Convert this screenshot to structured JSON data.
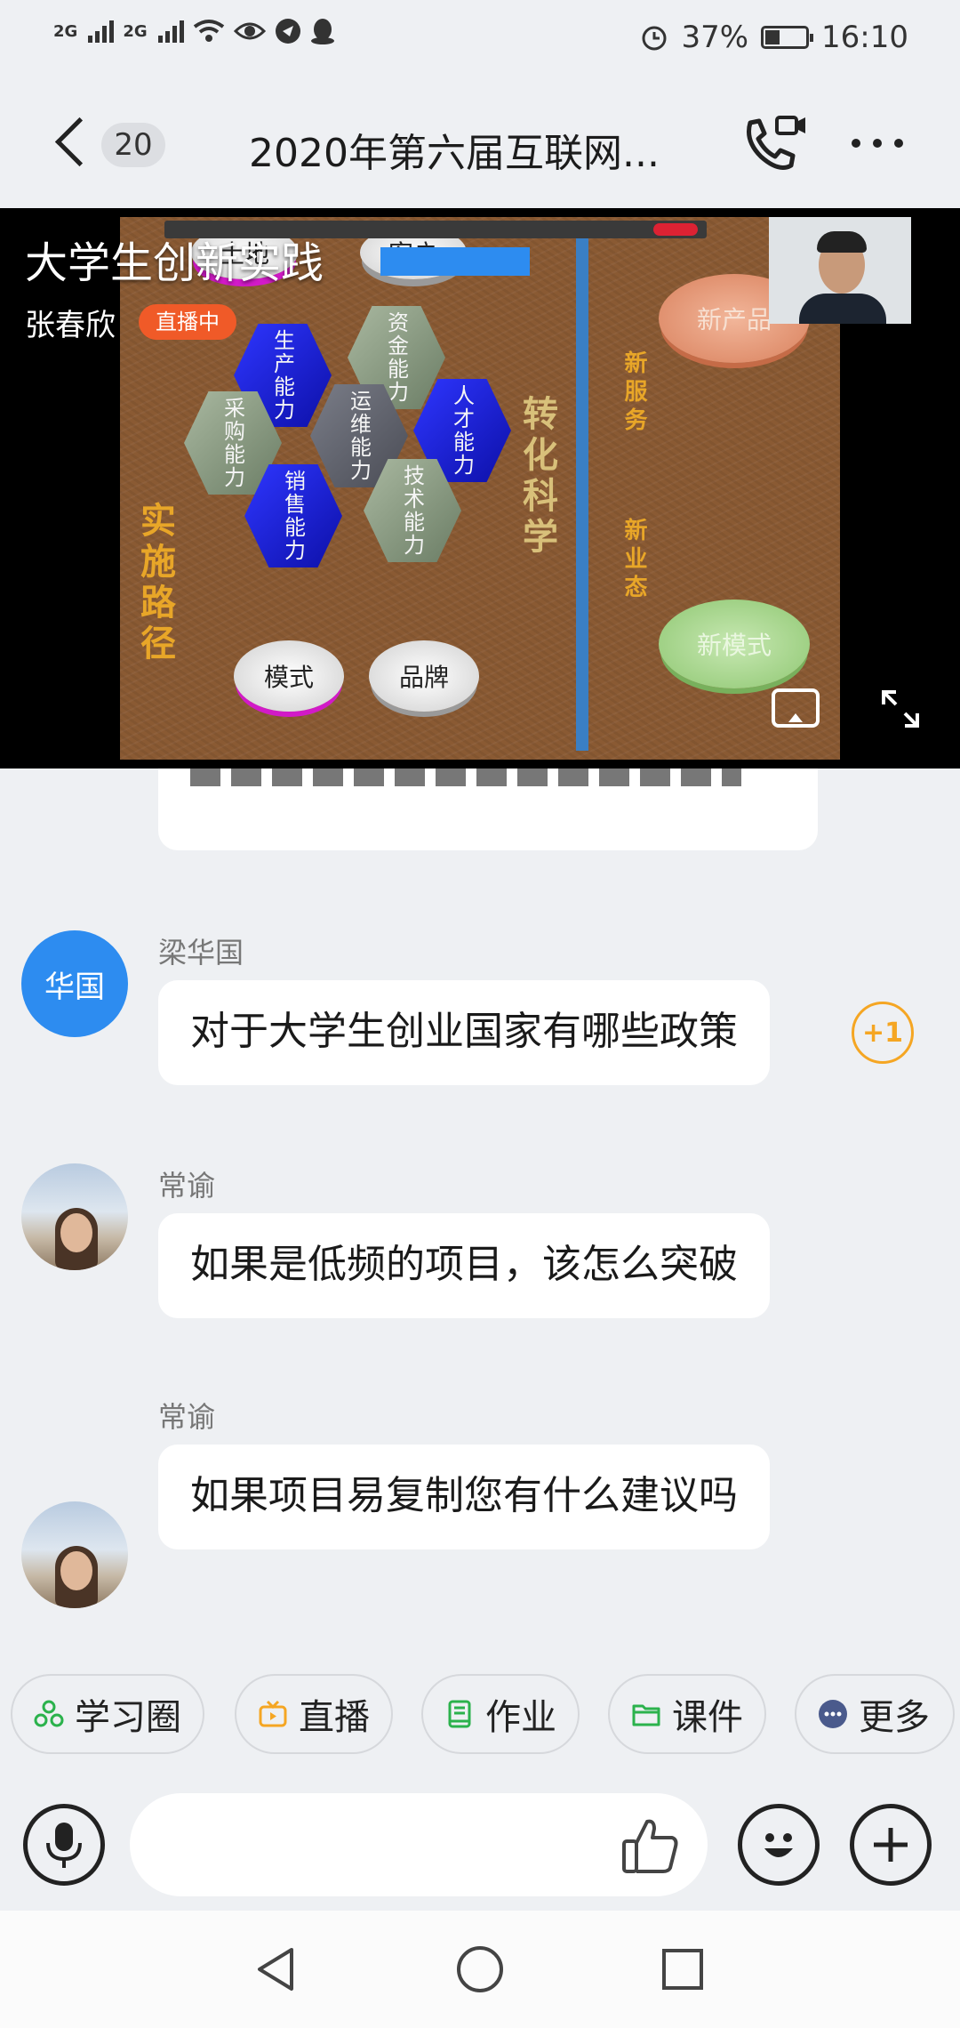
{
  "status_bar": {
    "signal1": "2G",
    "signal2": "2G",
    "battery": "37%",
    "battery_level": 0.37,
    "time": "16:10",
    "icons": [
      "signal-icon",
      "signal-icon",
      "wifi-icon",
      "eye-icon",
      "app-icon",
      "qq-icon",
      "alarm-icon",
      "battery-icon"
    ]
  },
  "header": {
    "back_count": "20",
    "title": "2020年第六届互联网..."
  },
  "video": {
    "title": "大学生创新实践",
    "presenter": "张春欣",
    "live_badge": "直播中",
    "slide": {
      "top_left_disc": "土地",
      "top_mid_disc": "客户",
      "hexagons": [
        "生产能力",
        "资金能力",
        "采购能力",
        "运维能力",
        "人才能力",
        "销售能力",
        "技术能力"
      ],
      "left_vertical": "实施路径",
      "center_vertical": "转化科学",
      "right_vertical_1": "新服务",
      "right_vertical_2": "新业态",
      "disc_new_product": "新产品",
      "disc_new_mode": "新模式",
      "disc_mode": "模式",
      "disc_brand": "品牌"
    }
  },
  "messages": [
    {
      "sender": "梁华国",
      "avatar_text": "华国",
      "text": "对于大学生创业国家有哪些政策",
      "reaction": "+1"
    },
    {
      "sender": "常谕",
      "text": "如果是低频的项目，该怎么突破"
    },
    {
      "sender": "常谕",
      "text": "如果项目易复制您有什么建议吗"
    }
  ],
  "quick_actions": [
    {
      "label": "学习圈",
      "icon": "circle-group-icon",
      "color": "#2bb24c"
    },
    {
      "label": "直播",
      "icon": "tv-icon",
      "color": "#f5a623"
    },
    {
      "label": "作业",
      "icon": "book-icon",
      "color": "#2bb24c"
    },
    {
      "label": "课件",
      "icon": "folder-icon",
      "color": "#2bb24c"
    },
    {
      "label": "更多",
      "icon": "more-dots-icon",
      "color": "#4a5a8c"
    }
  ],
  "input_bar": {
    "placeholder": ""
  }
}
